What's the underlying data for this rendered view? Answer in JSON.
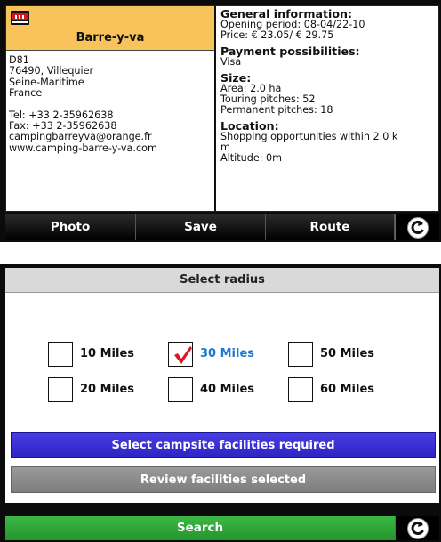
{
  "campsite": {
    "name": "Barre-y-va",
    "address_lines": [
      "D81",
      "76490, Villequier",
      "Seine-Maritime",
      "France"
    ],
    "contact_lines": [
      "Tel: +33 2-35962638",
      "Fax: +33 2-35962638",
      "campingbarreyva@orange.fr",
      "www.camping-barre-y-va.com"
    ]
  },
  "info": {
    "general_title": "General information:",
    "opening": "Opening period: 08-04/22-10",
    "price": "Price: € 23.05/ € 29.75",
    "payment_title": "Payment possibilities:",
    "payment": "Visa",
    "size_title": "Size:",
    "area": "Area: 2.0 ha",
    "touring": "Touring pitches: 52",
    "permanent": "Permanent pitches: 18",
    "location_title": "Location:",
    "shopping": "Shopping opportunities within 2.0 k",
    "shopping_unit": "m",
    "altitude": "Altitude: 0m"
  },
  "toolbar1": {
    "photo": "Photo",
    "save": "Save",
    "route": "Route"
  },
  "radius": {
    "title": "Select radius",
    "options": [
      {
        "label": "10 Miles",
        "selected": false
      },
      {
        "label": "30 Miles",
        "selected": true
      },
      {
        "label": "50 Miles",
        "selected": false
      },
      {
        "label": "20 Miles",
        "selected": false
      },
      {
        "label": "40 Miles",
        "selected": false
      },
      {
        "label": "60 Miles",
        "selected": false
      }
    ]
  },
  "buttons": {
    "facilities": "Select campsite facilities required",
    "review": "Review facilities selected",
    "search": "Search"
  },
  "colors": {
    "header": "#f7c35a",
    "selected_text": "#1e78d6",
    "check": "#e0141e",
    "facilities_button": "#3a30d8",
    "review_button": "#8c8c8c",
    "search_button": "#2aa534"
  },
  "icons": {
    "logo": "acsi-logo-icon",
    "back": "back-arrow-icon",
    "check": "checkmark-icon"
  }
}
